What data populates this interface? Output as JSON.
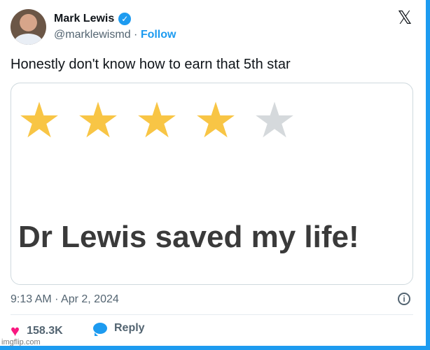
{
  "author": {
    "name": "Mark Lewis",
    "handle": "@marklewismd",
    "separator": " · ",
    "follow_label": "Follow",
    "verified_glyph": "✓"
  },
  "x_logo_glyph": "𝕏",
  "tweet": {
    "text": "Honestly don't know how to earn that 5th star"
  },
  "card": {
    "rating": 4,
    "rating_max": 5,
    "star_glyph": "★",
    "star_color_filled": "#f8c545",
    "star_color_empty": "#d5d9dc",
    "text": "Dr Lewis saved my life!"
  },
  "timestamp": "9:13 AM · Apr 2, 2024",
  "info_glyph": "i",
  "actions": {
    "likes_count": "158.3K",
    "reply_label": "Reply"
  },
  "watermark": "imgflip.com",
  "colors": {
    "accent": "#1d9bf0",
    "like": "#f91880"
  }
}
